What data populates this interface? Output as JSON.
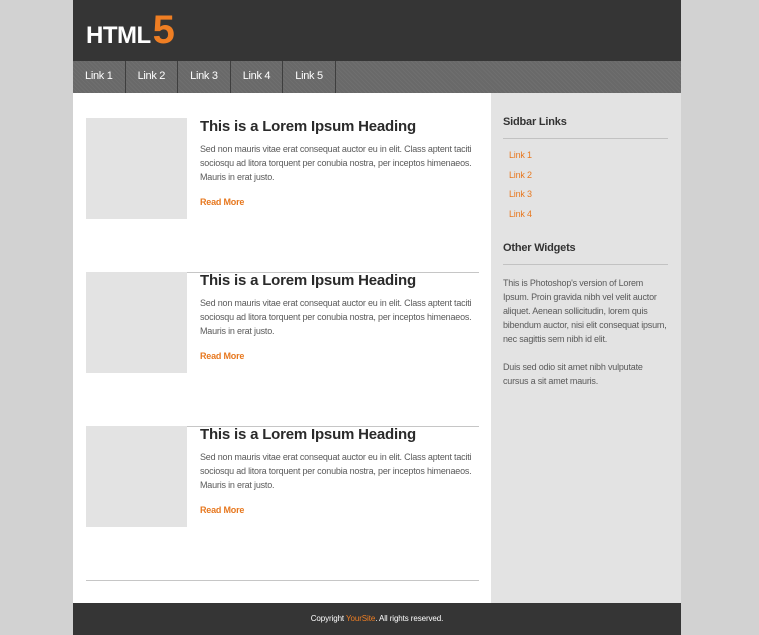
{
  "colors": {
    "accent": "#ef7e23",
    "header_bg": "#353535",
    "nav_bg": "#696969",
    "sidebar_bg": "#e3e3e3",
    "page_bg": "#d2d2d2"
  },
  "header": {
    "logo_text": "HTML",
    "logo_number": "5"
  },
  "nav": {
    "items": [
      {
        "label": "Link 1"
      },
      {
        "label": "Link 2"
      },
      {
        "label": "Link 3"
      },
      {
        "label": "Link 4"
      },
      {
        "label": "Link 5"
      }
    ]
  },
  "posts": [
    {
      "title": "This is a Lorem Ipsum  Heading",
      "text": "Sed non  mauris vitae erat consequat auctor eu in elit. Class aptent taciti sociosqu ad litora torquent per conubia nostra, per inceptos himenaeos. Mauris in erat justo.",
      "read_more": "Read More"
    },
    {
      "title": "This is a Lorem Ipsum  Heading",
      "text": "Sed non  mauris vitae erat consequat auctor eu in elit. Class aptent taciti sociosqu ad litora torquent per conubia nostra, per inceptos himenaeos. Mauris in erat justo.",
      "read_more": "Read More"
    },
    {
      "title": "This is a Lorem Ipsum  Heading",
      "text": "Sed non  mauris vitae erat consequat auctor eu in elit. Class aptent taciti sociosqu ad litora torquent per conubia nostra, per inceptos himenaeos. Mauris in erat justo.",
      "read_more": "Read More"
    }
  ],
  "sidebar": {
    "links_title": "Sidbar Links",
    "links": [
      "Link 1",
      "Link 2",
      "Link 3",
      "Link 4"
    ],
    "widgets_title": "Other Widgets",
    "widgets_para1": "This is Photoshop's version  of Lorem Ipsum. Proin gravida nibh vel velit auctor aliquet. Aenean sollicitudin, lorem quis bibendum auctor, nisi elit consequat ipsum, nec sagittis sem nibh id elit.",
    "widgets_para2": "Duis sed odio sit amet nibh vulputate cursus a sit amet mauris."
  },
  "footer": {
    "prefix": "Copyright ",
    "site": "YourSite",
    "suffix": ". All rights reserved."
  }
}
